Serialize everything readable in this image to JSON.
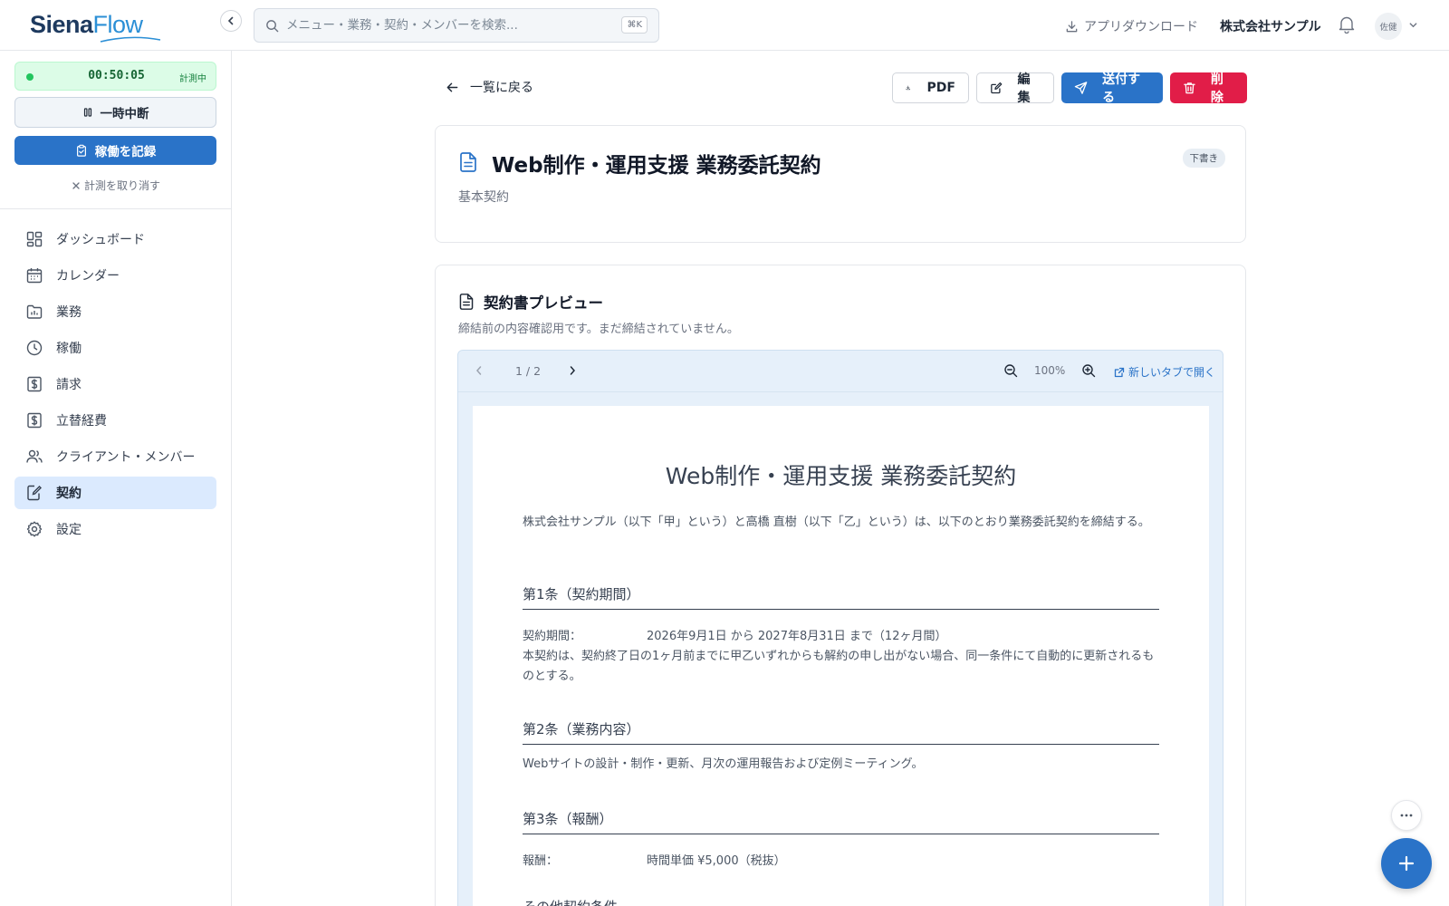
{
  "header": {
    "logo_part1": "Siena",
    "logo_part2": "Flow",
    "search_placeholder": "メニュー・業務・契約・メンバーを検索...",
    "search_shortcut": "⌘K",
    "app_download": "アプリダウンロード",
    "company": "株式会社サンプル",
    "user_avatar": "佐健"
  },
  "sidebar": {
    "timer": {
      "time": "00:50:05",
      "status": "計測中"
    },
    "pause_label": "一時中断",
    "record_label": "稼働を記録",
    "cancel_label": "計測を取り消す",
    "nav": [
      {
        "label": "ダッシュボード",
        "icon": "dashboard-icon"
      },
      {
        "label": "カレンダー",
        "icon": "calendar-icon"
      },
      {
        "label": "業務",
        "icon": "folder-icon"
      },
      {
        "label": "稼働",
        "icon": "clock-icon"
      },
      {
        "label": "請求",
        "icon": "dollar-icon"
      },
      {
        "label": "立替経費",
        "icon": "receipt-icon"
      },
      {
        "label": "クライアント・メンバー",
        "icon": "users-icon"
      },
      {
        "label": "契約",
        "icon": "contract-icon",
        "active": true
      },
      {
        "label": "設定",
        "icon": "gear-icon"
      }
    ]
  },
  "main": {
    "back_label": "一覧に戻る",
    "actions": {
      "pdf": "PDF",
      "edit": "編集",
      "send": "送付する",
      "delete": "削除"
    },
    "contract": {
      "title": "Web制作・運用支援 業務委託契約",
      "type": "基本契約",
      "status": "下書き"
    },
    "preview": {
      "heading": "契約書プレビュー",
      "description": "締結前の内容確認用です。まだ締結されていません。",
      "page_indicator": "1 / 2",
      "zoom": "100%",
      "open_new_tab": "新しいタブで開く",
      "document": {
        "title": "Web制作・運用支援 業務委託契約",
        "intro": "株式会社サンプル（以下「甲」という）と高橋 直樹（以下「乙」という）は、以下のとおり業務委託契約を締結する。",
        "articles": [
          {
            "heading": "第1条（契約期間）",
            "key": "契約期間：",
            "value": "2026年9月1日 から 2027年8月31日 まで（12ヶ月間）",
            "body": "本契約は、契約終了日の1ヶ月前までに甲乙いずれからも解約の申し出がない場合、同一条件にて自動的に更新されるものとする。"
          },
          {
            "heading": "第2条（業務内容）",
            "body": "Webサイトの設計・制作・更新、月次の運用報告および定例ミーティング。"
          },
          {
            "heading": "第3条（報酬）",
            "key": "報酬：",
            "value": "時間単価 ¥5,000（税抜）"
          },
          {
            "heading": "その他契約条件"
          }
        ]
      }
    }
  },
  "colors": {
    "primary": "#2a73c8",
    "danger": "#e11d48",
    "timer_bg": "#dcfce7",
    "active_nav": "#dbeafe"
  }
}
